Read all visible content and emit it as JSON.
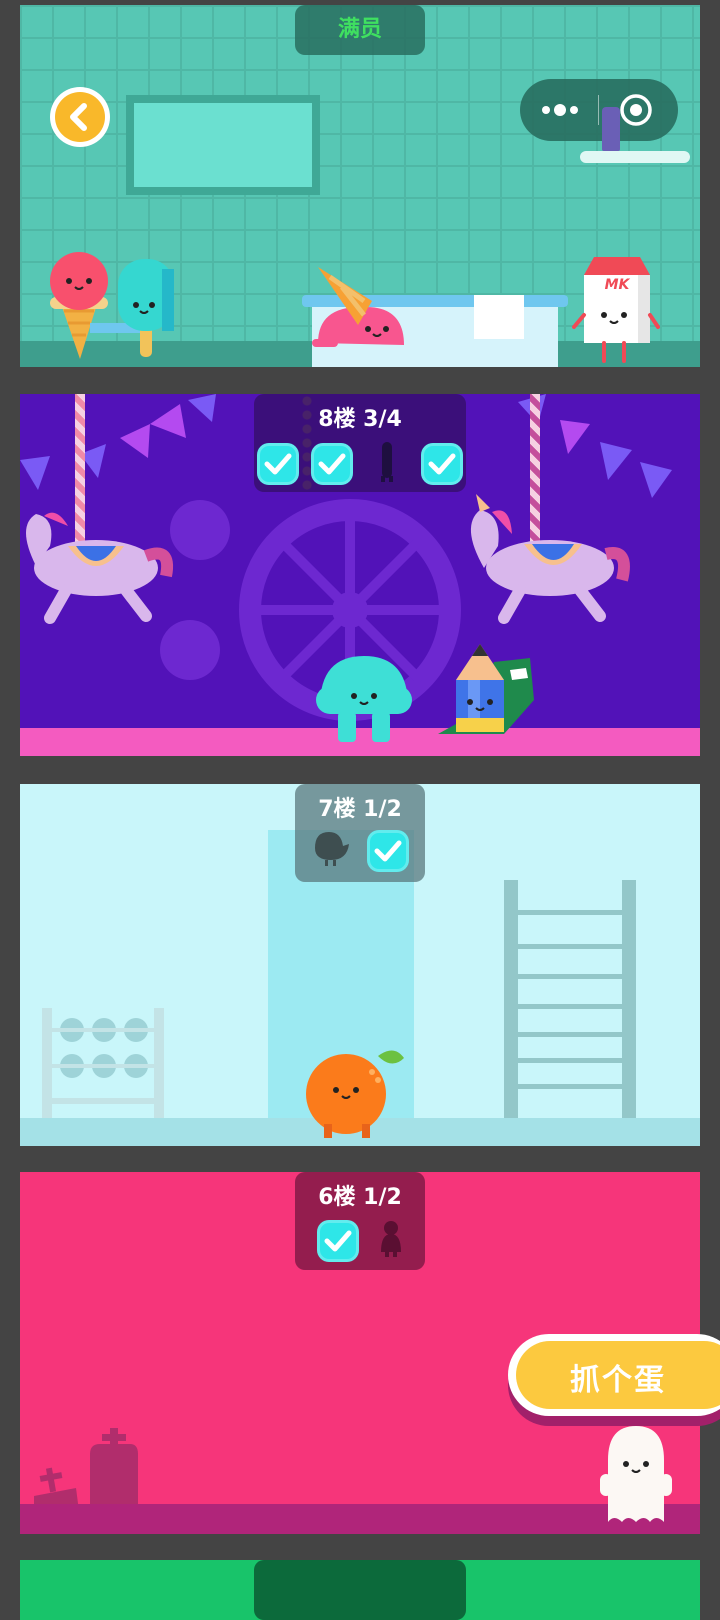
{
  "floors": [
    {
      "id": "floor9",
      "title": "满员",
      "checks": []
    },
    {
      "id": "floor8",
      "title": "8楼 3/4",
      "checks": [
        "done",
        "done",
        "empty",
        "done"
      ]
    },
    {
      "id": "floor7",
      "title": "7楼 1/2",
      "checks": [
        "empty",
        "done"
      ]
    },
    {
      "id": "floor6",
      "title": "6楼 1/2",
      "checks": [
        "done",
        "empty"
      ]
    }
  ],
  "top_bar": {
    "menu_icon": "more-dots-icon",
    "close_icon": "target-circle-icon"
  },
  "back_button": {
    "icon": "chevron-left-icon"
  },
  "milk_label": "MK",
  "catch_button": {
    "label": "抓个蛋"
  },
  "colors": {
    "floor9_bg": "#57c7b4",
    "floor8_bg": "#5212b8",
    "floor7_bg": "#c9f6fa",
    "floor6_bg": "#f6357a",
    "check": "#2ee6e8",
    "catch_button": "#fcc93f",
    "full_text": "#3fe060"
  }
}
